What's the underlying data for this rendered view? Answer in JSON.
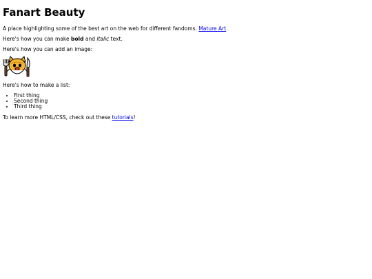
{
  "title": "Fanart Beauty",
  "intro": {
    "text": "A place highlighting some of the best art on the web for different fandoms. ",
    "link_label": "Mature Art",
    "suffix": "."
  },
  "format": {
    "prefix": "Here's how you can make ",
    "bold": "bold",
    "middle": " and ",
    "italic": "italic",
    "suffix": " text."
  },
  "image_section": {
    "text": "Here's how you can add an image:",
    "image_icon": "cat-with-fork-and-knife-icon"
  },
  "list_section": {
    "text": "Here's how to make a list:",
    "items": [
      "First thing",
      "Second thing",
      "Third thing"
    ]
  },
  "learn": {
    "prefix": "To learn more HTML/CSS, check out these ",
    "link_label": "tutorials",
    "suffix": "!"
  },
  "colors": {
    "link": "#0000ee",
    "text": "#000000",
    "cat_fill": "#f5b630"
  }
}
